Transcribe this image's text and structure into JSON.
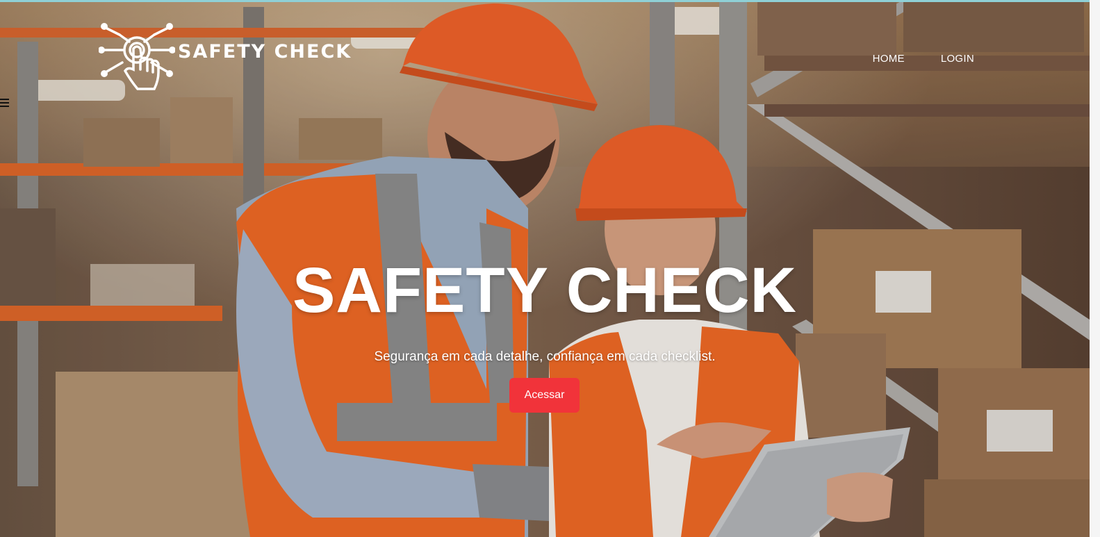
{
  "brand": {
    "name": "SAFETY CHECK",
    "logo_icon": "hand-touch-network-icon"
  },
  "nav": {
    "items": [
      {
        "label": "HOME"
      },
      {
        "label": "LOGIN"
      }
    ]
  },
  "menu": {
    "icon": "hamburger-menu-icon"
  },
  "hero": {
    "title": "SAFETY CHECK",
    "subtitle": "Segurança em cada detalhe, confiança em cada checklist.",
    "cta_label": "Acessar",
    "image": "warehouse workers in orange hard hats and high-visibility vests looking at a tablet"
  },
  "colors": {
    "accent": "#f1333a",
    "top_strip": "#8fd0d6",
    "text": "#ffffff"
  }
}
